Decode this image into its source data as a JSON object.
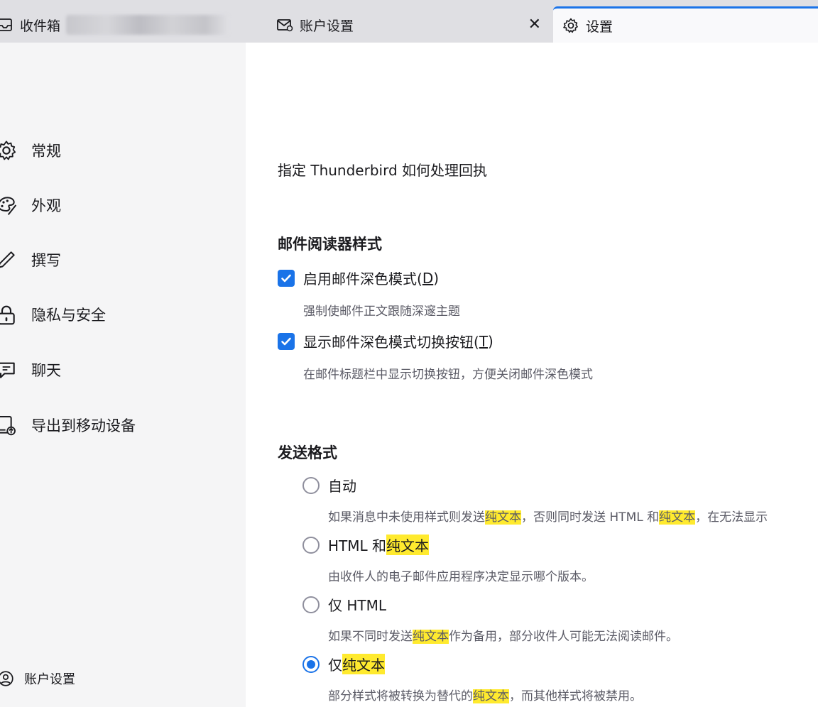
{
  "tabs": [
    {
      "label": "收件箱",
      "icon": "inbox-icon"
    },
    {
      "label": "账户设置",
      "icon": "account-settings-icon"
    },
    {
      "label": "设置",
      "icon": "gear-icon",
      "active": true
    }
  ],
  "close_glyph": "✕",
  "sidebar": {
    "items": [
      {
        "label": "常规",
        "icon": "gear-icon"
      },
      {
        "label": "外观",
        "icon": "palette-icon"
      },
      {
        "label": "撰写",
        "icon": "pencil-icon"
      },
      {
        "label": "隐私与安全",
        "icon": "lock-icon"
      },
      {
        "label": "聊天",
        "icon": "chat-icon"
      },
      {
        "label": "导出到移动设备",
        "icon": "export-device-icon"
      }
    ],
    "footer": {
      "label": "账户设置",
      "icon": "account-settings-icon"
    }
  },
  "main": {
    "intro": "指定 Thunderbird 如何处理回执",
    "reader_style": {
      "heading": "邮件阅读器样式",
      "options": [
        {
          "label": "启用邮件深色模式(",
          "accesskey": "D",
          "label_end": ")",
          "checked": true,
          "description": "强制使邮件正文跟随深邃主题"
        },
        {
          "label": "显示邮件深色模式切换按钮(",
          "accesskey": "T",
          "label_end": ")",
          "checked": true,
          "description": "在邮件标题栏中显示切换按钮，方便关闭邮件深色模式"
        }
      ]
    },
    "send_format": {
      "heading": "发送格式",
      "options": [
        {
          "label": "自动",
          "checked": false,
          "desc": {
            "a": "如果消息中未使用样式则发送",
            "hl1": "纯文本",
            "b": "，否则同时发送 HTML 和",
            "hl2": "纯文本",
            "c": "，在无法显示"
          }
        },
        {
          "label_a": "HTML 和",
          "label_hl": "纯文本",
          "checked": false,
          "description": "由收件人的电子邮件应用程序决定显示哪个版本。"
        },
        {
          "label": "仅 HTML",
          "checked": false,
          "desc": {
            "a": "如果不同时发送",
            "hl": "纯文本",
            "b": "作为备用，部分收件人可能无法阅读邮件。"
          }
        },
        {
          "label_a": "仅",
          "label_hl": "纯文本",
          "checked": true,
          "desc": {
            "a": "部分样式将被转换为替代的",
            "hl": "纯文本",
            "b": "，而其他样式将被禁用。"
          }
        }
      ]
    }
  },
  "colors": {
    "accent": "#1a73e8",
    "highlight": "#ffea2e",
    "sidebar_bg": "#f5f5f6",
    "tabstrip_bg": "#dfdfe3"
  }
}
